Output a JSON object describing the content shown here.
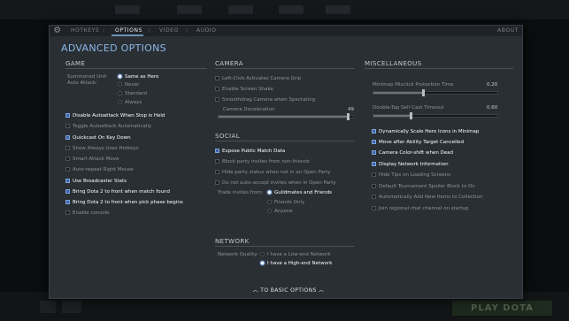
{
  "bottom": {
    "play_label": "PLAY DOTA"
  },
  "tabs": [
    {
      "label": "HOTKEYS",
      "active": false
    },
    {
      "label": "OPTIONS",
      "active": true
    },
    {
      "label": "VIDEO",
      "active": false
    },
    {
      "label": "AUDIO",
      "active": false
    }
  ],
  "tab_about": "ABOUT",
  "dialog_title": "ADVANCED OPTIONS",
  "game": {
    "title": "GAME",
    "summoned_label_1": "Summoned Unit",
    "summoned_label_2": "Auto Attack:",
    "summoned_options": [
      {
        "label": "Same as Hero",
        "selected": true
      },
      {
        "label": "Never",
        "selected": false
      },
      {
        "label": "Standard",
        "selected": false
      },
      {
        "label": "Always",
        "selected": false
      }
    ],
    "checkboxes": [
      {
        "label": "Disable Autoattack When Stop is Held",
        "checked": true
      },
      {
        "label": "Toggle Autoattack Automatically",
        "checked": false
      },
      {
        "label": "Quickcast On Key Down",
        "checked": true
      },
      {
        "label": "Show Always Uses Hotkeys",
        "checked": false
      },
      {
        "label": "Smart Attack Move",
        "checked": false
      },
      {
        "label": "Auto-repeat Right Mouse",
        "checked": false
      },
      {
        "label": "Use Broadcaster Stats",
        "checked": true
      },
      {
        "label": "Bring Dota 2 to front when match found",
        "checked": true
      },
      {
        "label": "Bring Dota 2 to front when pick phase begins",
        "checked": true
      },
      {
        "label": "Enable console",
        "checked": false
      }
    ]
  },
  "camera": {
    "title": "CAMERA",
    "checkboxes": [
      {
        "label": "Left-Click Activates Camera Grip",
        "checked": false
      },
      {
        "label": "Enable Screen Shake",
        "checked": false
      },
      {
        "label": "Smoothdrag Camera when Spectating",
        "checked": false
      }
    ],
    "deceleration_label": "Camera Deceleration",
    "deceleration_value": "49",
    "deceleration_fraction": 0.96
  },
  "social": {
    "title": "SOCIAL",
    "checkboxes": [
      {
        "label": "Expose Public Match Data",
        "checked": true
      },
      {
        "label": "Block party invites from non-friends",
        "checked": false
      },
      {
        "label": "Hide party status when not in an Open Party",
        "checked": false
      },
      {
        "label": "Do not auto-accept invites when in Open Party",
        "checked": false
      }
    ],
    "trade_label": "Trade invites from:",
    "trade_options": [
      {
        "label": "Guildmates and Friends",
        "selected": true
      },
      {
        "label": "Friends Only",
        "selected": false
      },
      {
        "label": "Anyone",
        "selected": false
      }
    ]
  },
  "network": {
    "title": "NETWORK",
    "quality_label": "Network Quality:",
    "options": [
      {
        "label": "I have a Low-end Network",
        "selected": false
      },
      {
        "label": "I have a High-end Network",
        "selected": true
      }
    ]
  },
  "misc": {
    "title": "MISCELLANEOUS",
    "minimap_label": "Minimap Misclick Protection Time",
    "minimap_value": "0.20",
    "minimap_fraction": 0.4,
    "doubletap_label": "Double-Tap Self Cast Timeout",
    "doubletap_value": "0.60",
    "doubletap_fraction": 0.3,
    "checkboxes": [
      {
        "label": "Dynamically Scale Hero Icons in Minimap",
        "checked": true
      },
      {
        "label": "Move after Ability Target Cancelled",
        "checked": true
      },
      {
        "label": "Camera Color-shift when Dead",
        "checked": true
      },
      {
        "label": "Display Network Information",
        "checked": true
      },
      {
        "label": "Hide Tips on Loading Screens",
        "checked": false
      },
      {
        "label": "Default Tournament Spoiler Block to On",
        "checked": false
      },
      {
        "label": "Automatically Add New Items to Collection",
        "checked": false
      },
      {
        "label": "Join regional chat channel on startup",
        "checked": false
      }
    ]
  },
  "footer_label": "TO BASIC OPTIONS",
  "colors": {
    "accent": "#89b8e6",
    "checked": "#3c63a5",
    "panel": "#2a2f34"
  }
}
